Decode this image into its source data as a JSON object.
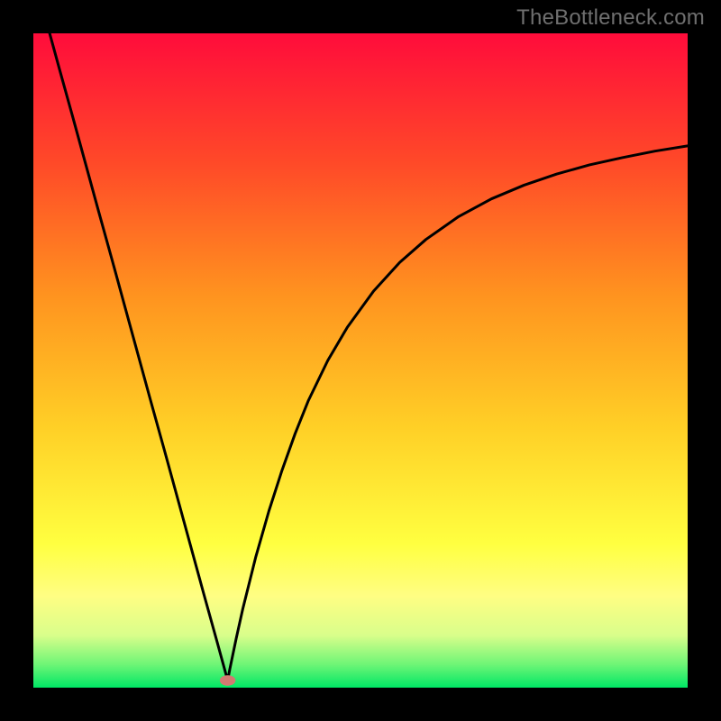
{
  "watermark": "TheBottleneck.com",
  "frame": {
    "bg": "#000000",
    "pad": 37,
    "inner": 726
  },
  "chart_data": {
    "type": "line",
    "title": "",
    "xlabel": "",
    "ylabel": "",
    "xlim": [
      0,
      100
    ],
    "ylim": [
      0,
      100
    ],
    "grid": false,
    "legend": false,
    "background_gradient": {
      "stops": [
        {
          "offset": 0.0,
          "color": "#ff0c3b"
        },
        {
          "offset": 0.2,
          "color": "#ff4a28"
        },
        {
          "offset": 0.4,
          "color": "#ff931f"
        },
        {
          "offset": 0.6,
          "color": "#ffcf26"
        },
        {
          "offset": 0.78,
          "color": "#ffff40"
        },
        {
          "offset": 0.86,
          "color": "#fffe83"
        },
        {
          "offset": 0.92,
          "color": "#d9fe8b"
        },
        {
          "offset": 0.965,
          "color": "#6df576"
        },
        {
          "offset": 1.0,
          "color": "#00e765"
        }
      ]
    },
    "curve": {
      "name": "bottleneck-curve",
      "x": [
        0,
        2,
        4,
        6,
        8,
        10,
        12,
        14,
        16,
        18,
        20,
        22,
        24,
        26,
        28,
        29.7,
        30,
        31,
        32,
        34,
        36,
        38,
        40,
        42,
        45,
        48,
        52,
        56,
        60,
        65,
        70,
        75,
        80,
        85,
        90,
        95,
        100
      ],
      "y": [
        109,
        101.8,
        94.5,
        87.3,
        80,
        72.7,
        65.5,
        58.2,
        50.9,
        43.6,
        36.4,
        29.1,
        21.8,
        14.5,
        7.3,
        1.1,
        2.7,
        7.5,
        12,
        20,
        27,
        33.2,
        38.8,
        43.8,
        50,
        55.1,
        60.6,
        65,
        68.5,
        72,
        74.7,
        76.8,
        78.5,
        79.9,
        81,
        82,
        82.8
      ]
    },
    "marker": {
      "cx": 29.7,
      "cy": 1.1,
      "rx": 1.2,
      "ry": 0.8,
      "color": "#d27a71"
    }
  }
}
